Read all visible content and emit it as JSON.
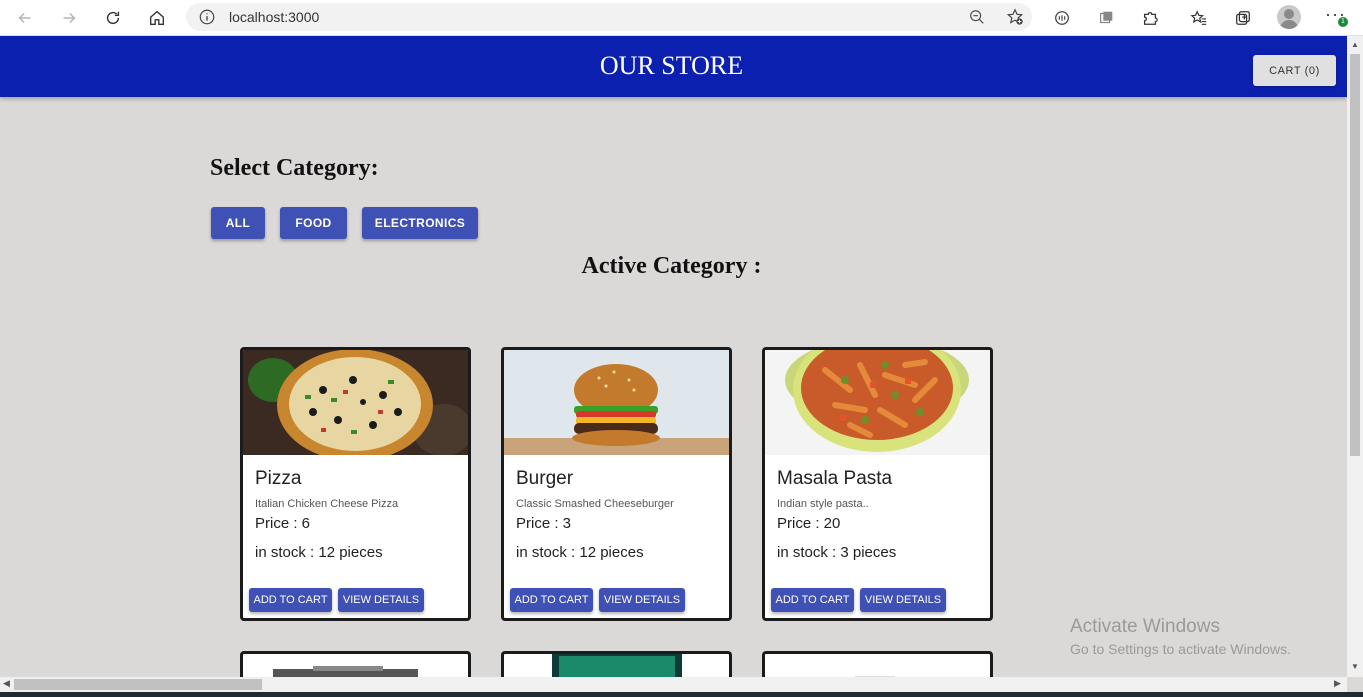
{
  "browser": {
    "url": "localhost:3000",
    "badge_count": "1"
  },
  "header": {
    "title": "OUR STORE",
    "cart_label": "CART (0)"
  },
  "category": {
    "heading": "Select Category:",
    "buttons": [
      "ALL",
      "FOOD",
      "ELECTRONICS"
    ],
    "active_heading": "Active Category :"
  },
  "products": [
    {
      "name": "Pizza",
      "description": "Italian Chicken Cheese Pizza",
      "price": "Price : 6",
      "stock": "in stock : 12 pieces",
      "add_label": "ADD TO CART",
      "view_label": "VIEW DETAILS"
    },
    {
      "name": "Burger",
      "description": "Classic Smashed Cheeseburger",
      "price": "Price : 3",
      "stock": "in stock : 12 pieces",
      "add_label": "ADD TO CART",
      "view_label": "VIEW DETAILS"
    },
    {
      "name": "Masala Pasta",
      "description": "Indian style pasta..",
      "price": "Price : 20",
      "stock": "in stock : 3 pieces",
      "add_label": "ADD TO CART",
      "view_label": "VIEW DETAILS"
    }
  ],
  "watermark": {
    "line1": "Activate Windows",
    "line2": "Go to Settings to activate Windows."
  },
  "colors": {
    "header_bg": "#0c20b0",
    "button_bg": "#3f51b5",
    "page_bg": "#dbd8d8"
  }
}
